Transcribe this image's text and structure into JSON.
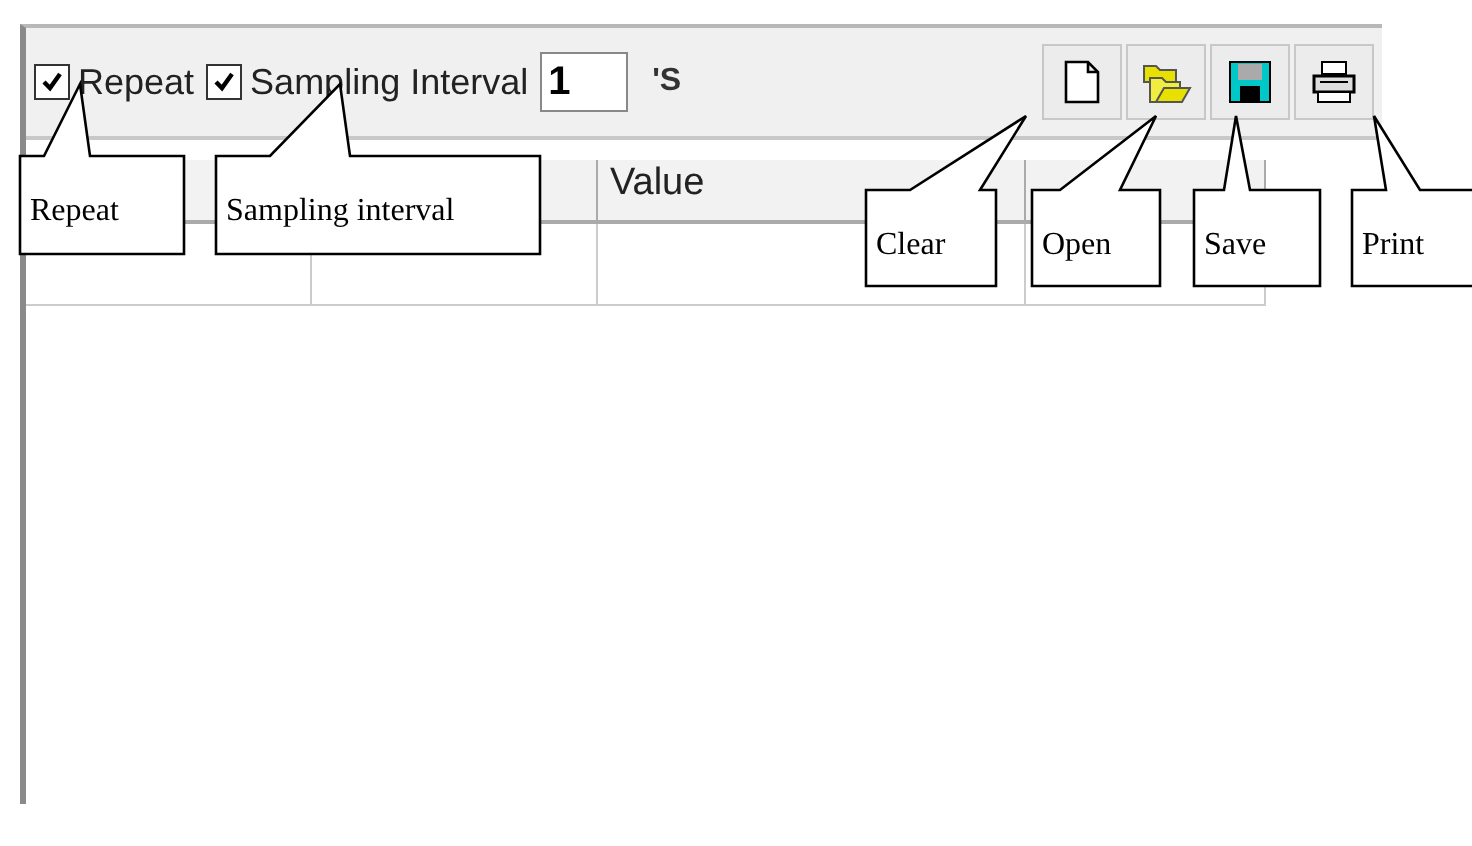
{
  "toolbar": {
    "repeat": {
      "label": "Repeat",
      "checked": true
    },
    "sampling": {
      "label": "Sampling Interval",
      "checked": true
    },
    "interval": {
      "value": "1"
    },
    "interval_unit": "'S",
    "buttons": [
      {
        "kind": "new"
      },
      {
        "kind": "open"
      },
      {
        "kind": "save"
      },
      {
        "kind": "print"
      }
    ]
  },
  "table": {
    "column_3": "Value"
  },
  "callouts": [
    {
      "text": "Repeat"
    },
    {
      "text": "Sampling interval"
    },
    {
      "text": "Clear"
    },
    {
      "text": "Open"
    },
    {
      "text": "Save"
    },
    {
      "text": "Print"
    }
  ]
}
